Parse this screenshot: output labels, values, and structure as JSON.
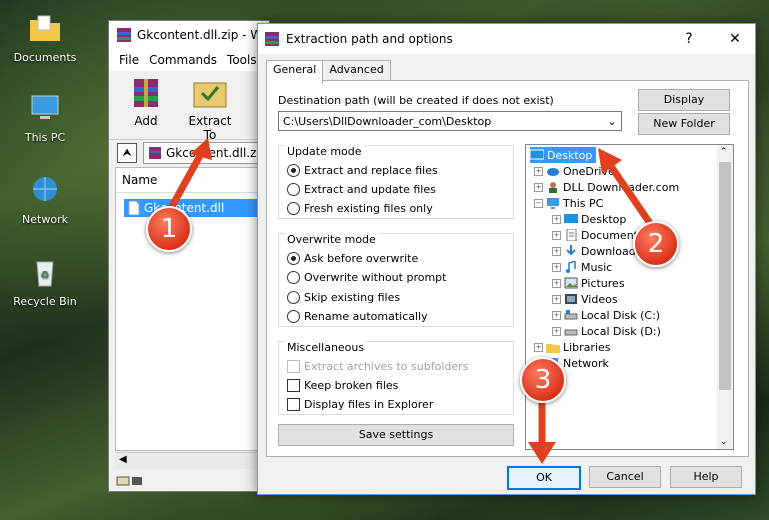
{
  "desktop": {
    "icons": [
      {
        "label": "Documents"
      },
      {
        "label": "This PC"
      },
      {
        "label": "Network"
      },
      {
        "label": "Recycle Bin"
      }
    ]
  },
  "winrar": {
    "title": "Gkcontent.dll.zip - W",
    "menu": [
      "File",
      "Commands",
      "Tools"
    ],
    "toolbar": {
      "add": "Add",
      "extract_to": "Extract To"
    },
    "address": "Gkcontent.dll.zip",
    "column_name": "Name",
    "file": "Gkcontent.dll"
  },
  "dialog": {
    "title": "Extraction path and options",
    "help_glyph": "?",
    "close_glyph": "✕",
    "tabs": [
      "General",
      "Advanced"
    ],
    "dest_label": "Destination path (will be created if does not exist)",
    "dest_value": "C:\\Users\\DllDownloader_com\\Desktop",
    "display_btn": "Display",
    "new_folder_btn": "New Folder",
    "update_mode": {
      "title": "Update mode",
      "options": [
        "Extract and replace files",
        "Extract and update files",
        "Fresh existing files only"
      ],
      "selected": 0
    },
    "overwrite_mode": {
      "title": "Overwrite mode",
      "options": [
        "Ask before overwrite",
        "Overwrite without prompt",
        "Skip existing files",
        "Rename automatically"
      ],
      "selected": 0
    },
    "misc": {
      "title": "Miscellaneous",
      "options": [
        "Extract archives to subfolders",
        "Keep broken files",
        "Display files in Explorer"
      ],
      "disabled": [
        true,
        false,
        false
      ]
    },
    "save_settings": "Save settings",
    "tree": [
      {
        "label": "Desktop",
        "selected": true
      },
      {
        "label": "OneDrive"
      },
      {
        "label": "DLL Downloader.com"
      },
      {
        "label": "This PC"
      },
      {
        "label": "Desktop"
      },
      {
        "label": "Documents"
      },
      {
        "label": "Downloads"
      },
      {
        "label": "Music"
      },
      {
        "label": "Pictures"
      },
      {
        "label": "Videos"
      },
      {
        "label": "Local Disk (C:)"
      },
      {
        "label": "Local Disk (D:)"
      },
      {
        "label": "Libraries"
      },
      {
        "label": "Network"
      }
    ],
    "ok": "OK",
    "cancel": "Cancel",
    "help": "Help"
  },
  "callouts": [
    "1",
    "2",
    "3"
  ],
  "colors": {
    "accent": "#0078d7",
    "callout": "#e0401f",
    "selection": "#3399ff"
  }
}
